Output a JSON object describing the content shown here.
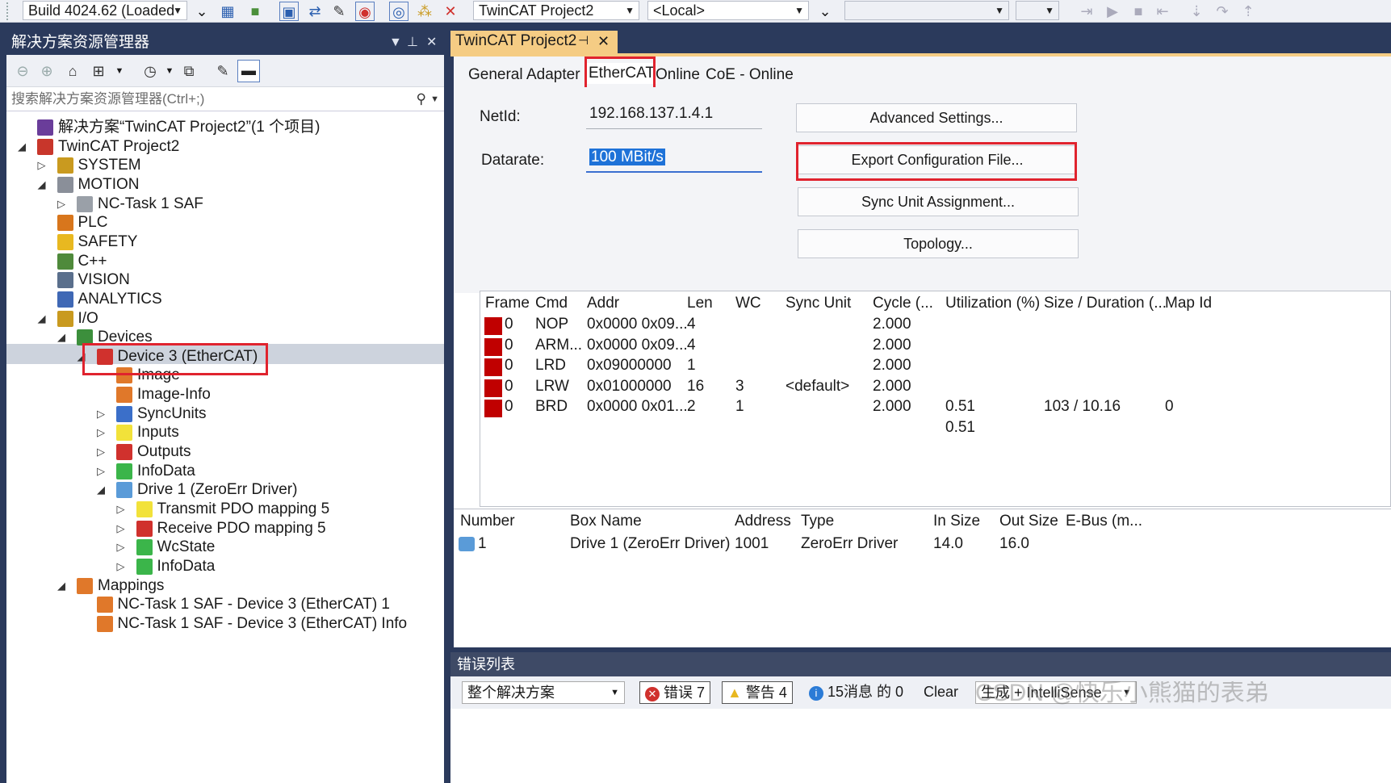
{
  "toolbar": {
    "build_combo": "Build 4024.62 (Loaded",
    "project_combo": "TwinCAT Project2",
    "target_combo": "<Local>"
  },
  "solution_explorer": {
    "title": "解决方案资源管理器",
    "search_placeholder": "搜索解决方案资源管理器(Ctrl+;)",
    "tree": [
      {
        "label": "解决方案“TwinCAT Project2”(1 个项目)",
        "level": 0,
        "arrow": "",
        "icon": "solution-icon",
        "color": "#6a3d9a"
      },
      {
        "label": "TwinCAT Project2",
        "level": 0,
        "arrow": "◢",
        "icon": "project-icon",
        "color": "#c8362b"
      },
      {
        "label": "SYSTEM",
        "level": 1,
        "arrow": "▷",
        "icon": "system-icon",
        "color": "#c99a1f"
      },
      {
        "label": "MOTION",
        "level": 1,
        "arrow": "◢",
        "icon": "motion-icon",
        "color": "#8a8f99"
      },
      {
        "label": "NC-Task 1 SAF",
        "level": 2,
        "arrow": "▷",
        "icon": "nc-task-icon",
        "color": "#9aa0a8"
      },
      {
        "label": "PLC",
        "level": 1,
        "arrow": "",
        "icon": "plc-icon",
        "color": "#d8761c"
      },
      {
        "label": "SAFETY",
        "level": 1,
        "arrow": "",
        "icon": "safety-icon",
        "color": "#e8b820"
      },
      {
        "label": "C++",
        "level": 1,
        "arrow": "",
        "icon": "cpp-icon",
        "color": "#4f8a3b"
      },
      {
        "label": "VISION",
        "level": 1,
        "arrow": "",
        "icon": "vision-icon",
        "color": "#5a6f8c"
      },
      {
        "label": "ANALYTICS",
        "level": 1,
        "arrow": "",
        "icon": "analytics-icon",
        "color": "#3f68b5"
      },
      {
        "label": "I/O",
        "level": 1,
        "arrow": "◢",
        "icon": "io-icon",
        "color": "#c99a1f"
      },
      {
        "label": "Devices",
        "level": 2,
        "arrow": "◢",
        "icon": "devices-icon",
        "color": "#3c8f3c"
      },
      {
        "label": "Device 3 (EtherCAT)",
        "level": 3,
        "arrow": "◢",
        "icon": "ethercat-device-icon",
        "color": "#d0312d"
      },
      {
        "label": "Image",
        "level": 4,
        "arrow": "",
        "icon": "image-icon",
        "color": "#e0782a"
      },
      {
        "label": "Image-Info",
        "level": 4,
        "arrow": "",
        "icon": "image-info-icon",
        "color": "#e0782a"
      },
      {
        "label": "SyncUnits",
        "level": 4,
        "arrow": "▷",
        "icon": "syncunits-icon",
        "color": "#3b6fc9"
      },
      {
        "label": "Inputs",
        "level": 4,
        "arrow": "▷",
        "icon": "inputs-icon",
        "color": "#f2e23a"
      },
      {
        "label": "Outputs",
        "level": 4,
        "arrow": "▷",
        "icon": "outputs-icon",
        "color": "#d0312d"
      },
      {
        "label": "InfoData",
        "level": 4,
        "arrow": "▷",
        "icon": "infodata-icon",
        "color": "#3bb54a"
      },
      {
        "label": "Drive 1 (ZeroErr Driver)",
        "level": 4,
        "arrow": "◢",
        "icon": "drive-icon",
        "color": "#5a9bd8"
      },
      {
        "label": "Transmit PDO mapping 5",
        "level": 5,
        "arrow": "▷",
        "icon": "tx-pdo-icon",
        "color": "#f2e23a"
      },
      {
        "label": "Receive PDO mapping 5",
        "level": 5,
        "arrow": "▷",
        "icon": "rx-pdo-icon",
        "color": "#d0312d"
      },
      {
        "label": "WcState",
        "level": 5,
        "arrow": "▷",
        "icon": "wcstate-icon",
        "color": "#3bb54a"
      },
      {
        "label": "InfoData",
        "level": 5,
        "arrow": "▷",
        "icon": "infodata-icon",
        "color": "#3bb54a"
      },
      {
        "label": "Mappings",
        "level": 2,
        "arrow": "◢",
        "icon": "mappings-icon",
        "color": "#e0782a"
      },
      {
        "label": "NC-Task 1 SAF - Device 3 (EtherCAT) 1",
        "level": 3,
        "arrow": "",
        "icon": "mapping-item-icon",
        "color": "#e0782a"
      },
      {
        "label": "NC-Task 1 SAF - Device 3 (EtherCAT) Info",
        "level": 3,
        "arrow": "",
        "icon": "mapping-item-icon",
        "color": "#e0782a"
      }
    ]
  },
  "document": {
    "tab_title": "TwinCAT Project2",
    "tabs": [
      "General",
      "Adapter",
      "EtherCAT",
      "Online",
      "CoE - Online"
    ],
    "netid_label": "NetId:",
    "netid_value": "192.168.137.1.4.1",
    "datarate_label": "Datarate:",
    "datarate_value": "100 MBit/s",
    "buttons": {
      "advanced": "Advanced Settings...",
      "export": "Export Configuration File...",
      "sync_unit": "Sync Unit Assignment...",
      "topology": "Topology..."
    },
    "frame_table": {
      "headers": [
        "Frame",
        "Cmd",
        "Addr",
        "Len",
        "WC",
        "Sync Unit",
        "Cycle (...",
        "Utilization (%)",
        "Size / Duration (...",
        "Map Id"
      ],
      "rows": [
        [
          "0",
          "NOP",
          "0x0000 0x09...",
          "4",
          "",
          "",
          "2.000",
          "",
          "",
          ""
        ],
        [
          "0",
          "ARM...",
          "0x0000 0x09...",
          "4",
          "",
          "",
          "2.000",
          "",
          "",
          ""
        ],
        [
          "0",
          "LRD",
          "0x09000000",
          "1",
          "",
          "",
          "2.000",
          "",
          "",
          ""
        ],
        [
          "0",
          "LRW",
          "0x01000000",
          "16",
          "3",
          "<default>",
          "2.000",
          "",
          "",
          ""
        ],
        [
          "0",
          "BRD",
          "0x0000 0x01...",
          "2",
          "1",
          "",
          "2.000",
          "0.51",
          "103 / 10.16",
          "0"
        ]
      ],
      "footer_utilization": "0.51"
    },
    "box_table": {
      "headers": [
        "Number",
        "Box Name",
        "Address",
        "Type",
        "In Size",
        "Out Size",
        "E-Bus (m..."
      ],
      "rows": [
        [
          "1",
          "Drive 1 (ZeroErr Driver)",
          "1001",
          "ZeroErr Driver",
          "14.0",
          "16.0",
          ""
        ]
      ]
    }
  },
  "error_list": {
    "title": "错误列表",
    "scope": "整个解决方案",
    "errors": "错误 7",
    "warnings": "警告 4",
    "messages": "15消息 的 0",
    "clear": "Clear",
    "build_filter": "生成 + IntelliSense",
    "watermark": "CSDN @快乐小熊猫的表弟"
  },
  "colors": {
    "chrome_dark": "#2b3a5c",
    "active_tab": "#f5cc84",
    "highlight_red": "#e0232e",
    "status_red": "#c00000"
  }
}
